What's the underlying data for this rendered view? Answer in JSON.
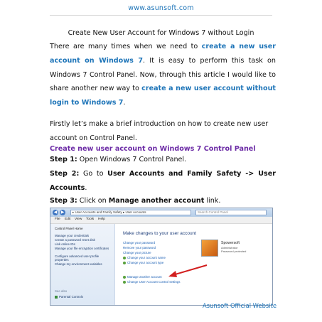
{
  "header": {
    "site_url": "www.asunsoft.com"
  },
  "doc": {
    "title": "Create New User Account for Windows 7 without Login",
    "p1": {
      "t1": "There are many times when we need to ",
      "link1": "create a new user account on Windows 7",
      "t2": ". It is easy to perform this task on Windows 7 Control Panel. Now, through this article I would like to share another new way to ",
      "link2": "create a new user account without login to Windows 7",
      "t3": "."
    },
    "p2": "Firstly let’s make a brief introduction on how to create new user account on Control Panel.",
    "section_heading": "Create new user account on Windows 7 Control Panel",
    "step1": {
      "label": "Step 1:",
      "text": " Open Windows 7 Control Panel."
    },
    "step2": {
      "label": "Step 2:",
      "text1": " Go to ",
      "bold": "User Accounts and Family Safety -> User Accounts",
      "text2": "."
    },
    "step3": {
      "label": "Step 3:",
      "text1": " Click on ",
      "bold": "Manage another account",
      "text2": " link."
    }
  },
  "screenshot": {
    "address": "▸ User Accounts and Family Safety ▸ User Accounts",
    "search_placeholder": "Search Control Panel",
    "menu": [
      "File",
      "Edit",
      "View",
      "Tools",
      "Help"
    ],
    "sidebar": {
      "home": "Control Panel Home",
      "items": [
        "Manage your credentials",
        "Create a password reset disk",
        "Link online IDs",
        "Manage your file encryption certificates",
        "Configure advanced user profile properties",
        "Change my environment variables"
      ],
      "see_also": "See also",
      "parental": "Parental Controls"
    },
    "content_title": "Make changes to your user account",
    "tasks": [
      "Change your password",
      "Remove your password",
      "Change your picture",
      "Change your account name",
      "Change your account type"
    ],
    "tasks_lower": [
      "Manage another account",
      "Change User Account Control settings"
    ],
    "user": {
      "name": "Spowersoft",
      "role": "Administrator",
      "status": "Password protected"
    },
    "colors": {
      "arrow": "#d21f1f",
      "link": "#1a5fb4"
    }
  },
  "footer": {
    "text": "Asunsoft Official Website"
  }
}
